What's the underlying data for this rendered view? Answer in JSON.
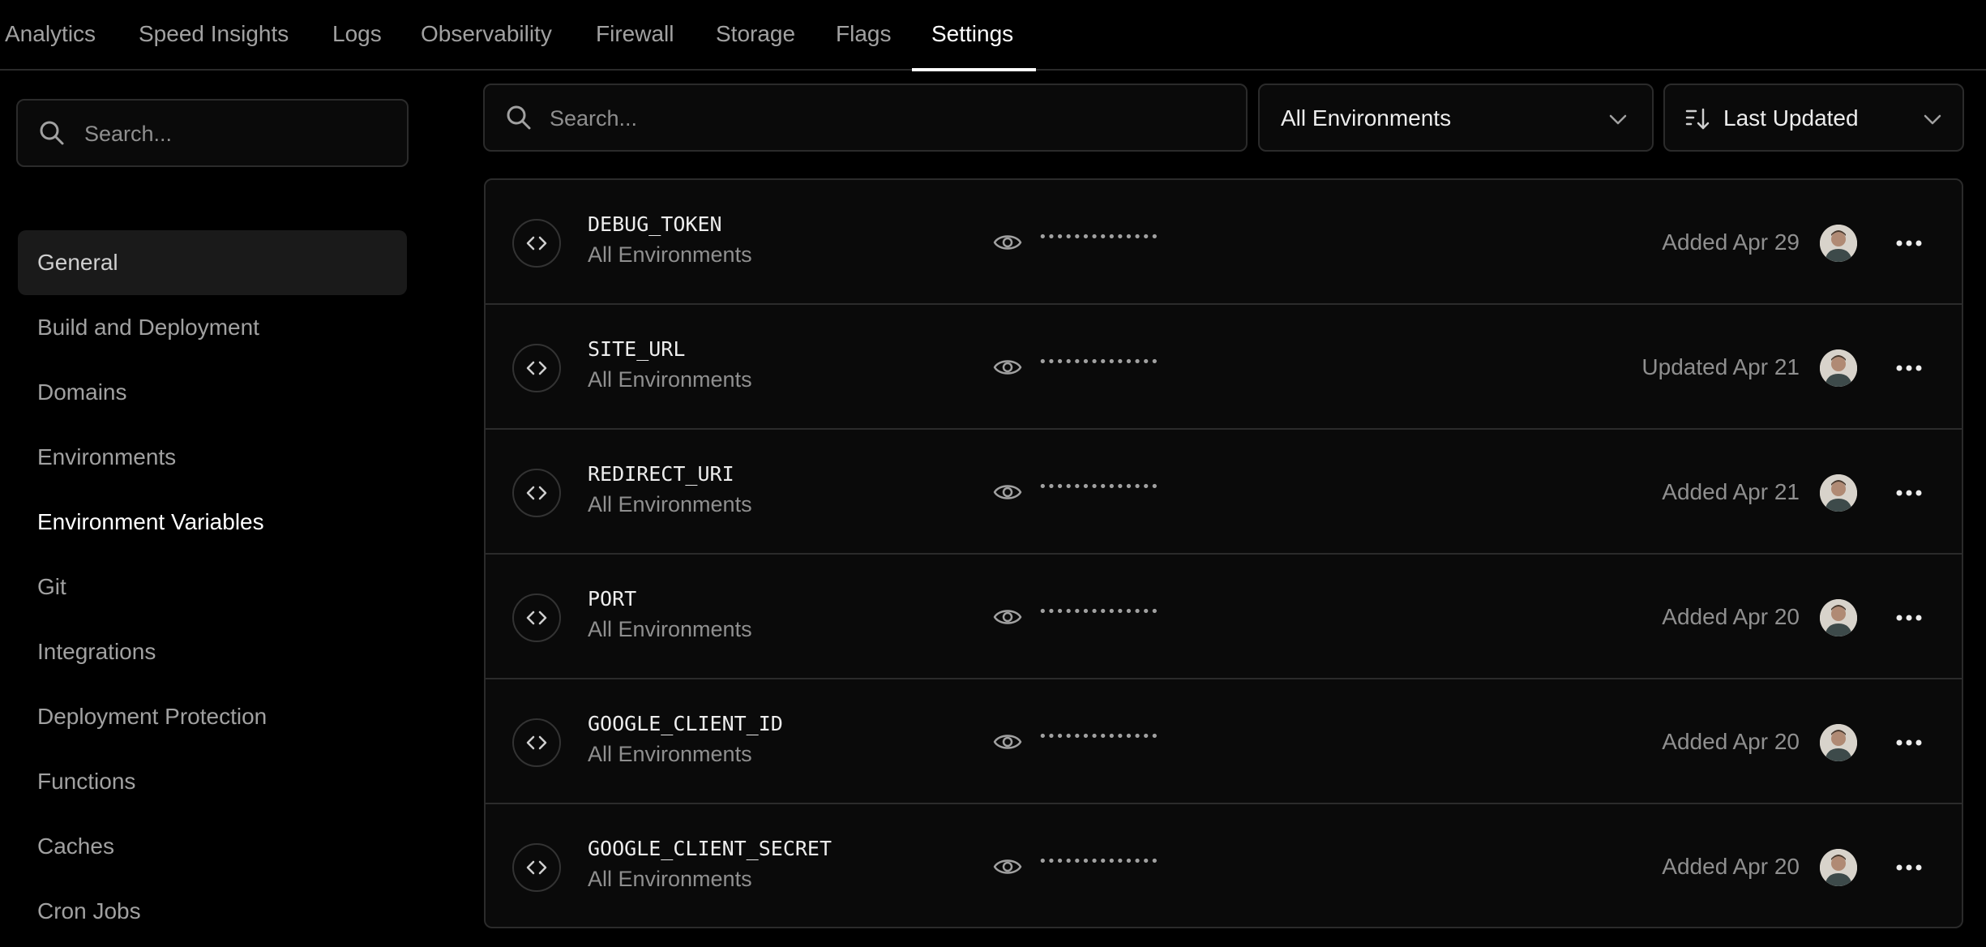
{
  "topnav": {
    "tabs": [
      {
        "label": "Analytics"
      },
      {
        "label": "Speed Insights"
      },
      {
        "label": "Logs"
      },
      {
        "label": "Observability"
      },
      {
        "label": "Firewall"
      },
      {
        "label": "Storage"
      },
      {
        "label": "Flags"
      },
      {
        "label": "Settings",
        "active": true
      }
    ]
  },
  "sidebar": {
    "search_placeholder": "Search...",
    "items": [
      {
        "label": "General"
      },
      {
        "label": "Build and Deployment"
      },
      {
        "label": "Domains"
      },
      {
        "label": "Environments"
      },
      {
        "label": "Environment Variables"
      },
      {
        "label": "Git"
      },
      {
        "label": "Integrations"
      },
      {
        "label": "Deployment Protection"
      },
      {
        "label": "Functions"
      },
      {
        "label": "Caches"
      },
      {
        "label": "Cron Jobs"
      }
    ]
  },
  "toolbar": {
    "search_placeholder": "Search...",
    "environment_filter": "All Environments",
    "sort": "Last Updated"
  },
  "env_vars": [
    {
      "name": "DEBUG_TOKEN",
      "environment": "All Environments",
      "value_masked": "••••••••••••••",
      "updated": "Added Apr 29"
    },
    {
      "name": "SITE_URL",
      "environment": "All Environments",
      "value_masked": "••••••••••••••",
      "updated": "Updated Apr 21"
    },
    {
      "name": "REDIRECT_URI",
      "environment": "All Environments",
      "value_masked": "••••••••••••••",
      "updated": "Added Apr 21"
    },
    {
      "name": "PORT",
      "environment": "All Environments",
      "value_masked": "••••••••••••••",
      "updated": "Added Apr 20"
    },
    {
      "name": "GOOGLE_CLIENT_ID",
      "environment": "All Environments",
      "value_masked": "••••••••••••••",
      "updated": "Added Apr 20"
    },
    {
      "name": "GOOGLE_CLIENT_SECRET",
      "environment": "All Environments",
      "value_masked": "••••••••••••••",
      "updated": "Added Apr 20"
    }
  ],
  "colors": {
    "background": "#000000",
    "surface": "#0a0a0a",
    "border": "#2b2b2b",
    "text_primary": "#ededed",
    "text_muted": "#8f8f8f"
  }
}
